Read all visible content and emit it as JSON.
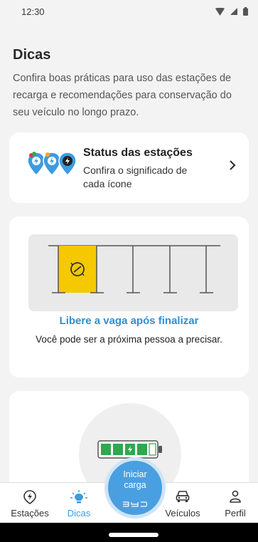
{
  "status_bar": {
    "time": "12:30"
  },
  "page": {
    "title": "Dicas",
    "description": "Confira boas práticas para uso das estações de recarga e recomendações para conservação do seu veículo no longo prazo."
  },
  "cards": {
    "status": {
      "title": "Status das estações",
      "subtitle": "Confira o significado de cada ícone"
    },
    "vaga": {
      "title": "Libere a vaga após finalizar",
      "subtitle": "Você pode ser a próxima pessoa a precisar."
    }
  },
  "nav": {
    "items": [
      {
        "label": "Estações",
        "icon": "charging-pin-icon"
      },
      {
        "label": "Dicas",
        "icon": "lightbulb-icon"
      },
      {
        "label": "Veículos",
        "icon": "car-icon"
      },
      {
        "label": "Perfil",
        "icon": "person-icon"
      }
    ],
    "fab_label": "Iniciar carga",
    "fab_brand": "BYD"
  },
  "colors": {
    "accent": "#3d9be0",
    "fab": "#4a9fe0",
    "highlight": "#f5c800",
    "battery": "#2fa84f"
  }
}
